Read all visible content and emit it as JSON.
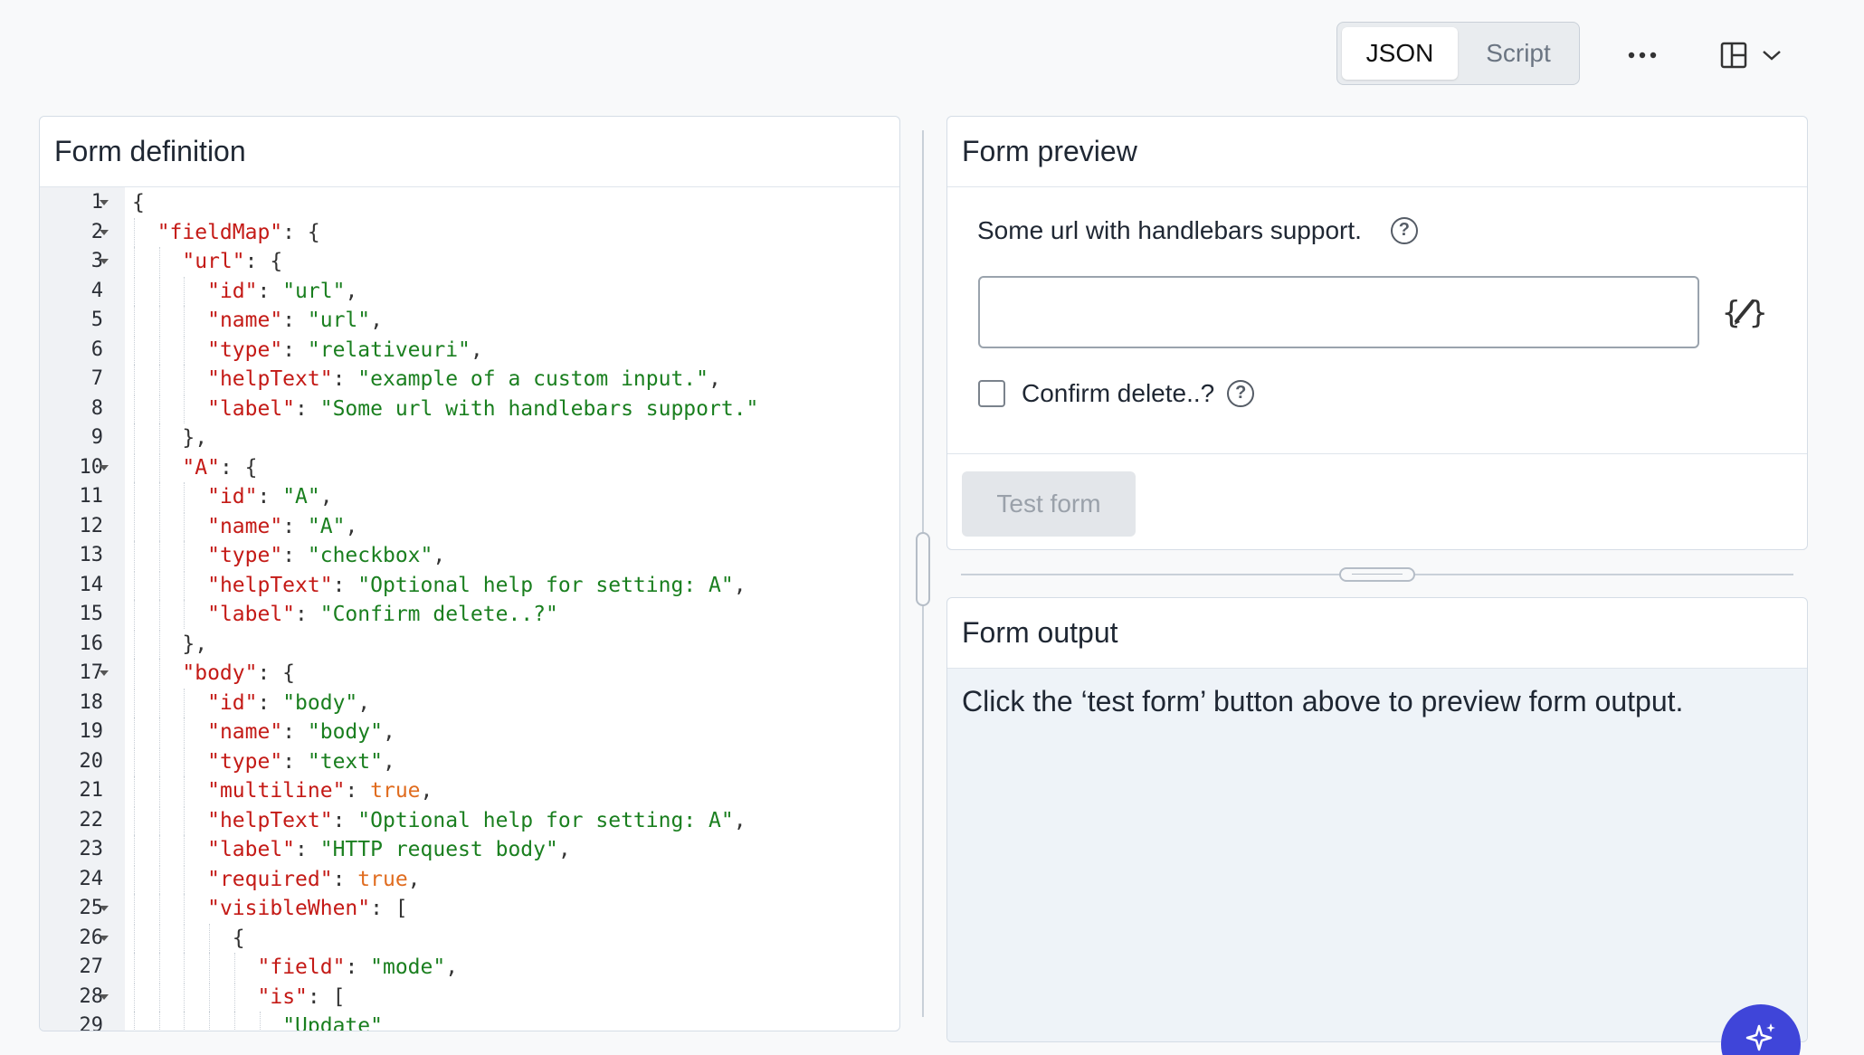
{
  "toolbar": {
    "tabs": [
      {
        "label": "JSON",
        "active": true
      },
      {
        "label": "Script",
        "active": false
      }
    ],
    "more_icon": "more-horizontal-icon",
    "layout_icon": "layout-icon"
  },
  "definition": {
    "title": "Form definition",
    "lines": [
      {
        "n": "1",
        "fold": true,
        "indent": 0,
        "tokens": [
          {
            "t": "p",
            "v": "{"
          }
        ]
      },
      {
        "n": "2",
        "fold": true,
        "indent": 1,
        "tokens": [
          {
            "t": "k",
            "v": "\"fieldMap\""
          },
          {
            "t": "p",
            "v": ": {"
          }
        ]
      },
      {
        "n": "3",
        "fold": true,
        "indent": 2,
        "tokens": [
          {
            "t": "k",
            "v": "\"url\""
          },
          {
            "t": "p",
            "v": ": {"
          }
        ]
      },
      {
        "n": "4",
        "fold": false,
        "indent": 3,
        "tokens": [
          {
            "t": "k",
            "v": "\"id\""
          },
          {
            "t": "p",
            "v": ": "
          },
          {
            "t": "s",
            "v": "\"url\""
          },
          {
            "t": "p",
            "v": ","
          }
        ]
      },
      {
        "n": "5",
        "fold": false,
        "indent": 3,
        "tokens": [
          {
            "t": "k",
            "v": "\"name\""
          },
          {
            "t": "p",
            "v": ": "
          },
          {
            "t": "s",
            "v": "\"url\""
          },
          {
            "t": "p",
            "v": ","
          }
        ]
      },
      {
        "n": "6",
        "fold": false,
        "indent": 3,
        "tokens": [
          {
            "t": "k",
            "v": "\"type\""
          },
          {
            "t": "p",
            "v": ": "
          },
          {
            "t": "s",
            "v": "\"relativeuri\""
          },
          {
            "t": "p",
            "v": ","
          }
        ]
      },
      {
        "n": "7",
        "fold": false,
        "indent": 3,
        "tokens": [
          {
            "t": "k",
            "v": "\"helpText\""
          },
          {
            "t": "p",
            "v": ": "
          },
          {
            "t": "s",
            "v": "\"example of a custom input.\""
          },
          {
            "t": "p",
            "v": ","
          }
        ]
      },
      {
        "n": "8",
        "fold": false,
        "indent": 3,
        "tokens": [
          {
            "t": "k",
            "v": "\"label\""
          },
          {
            "t": "p",
            "v": ": "
          },
          {
            "t": "s",
            "v": "\"Some url with handlebars support.\""
          }
        ]
      },
      {
        "n": "9",
        "fold": false,
        "indent": 2,
        "tokens": [
          {
            "t": "p",
            "v": "},"
          }
        ]
      },
      {
        "n": "10",
        "fold": true,
        "indent": 2,
        "tokens": [
          {
            "t": "k",
            "v": "\"A\""
          },
          {
            "t": "p",
            "v": ": {"
          }
        ]
      },
      {
        "n": "11",
        "fold": false,
        "indent": 3,
        "tokens": [
          {
            "t": "k",
            "v": "\"id\""
          },
          {
            "t": "p",
            "v": ": "
          },
          {
            "t": "s",
            "v": "\"A\""
          },
          {
            "t": "p",
            "v": ","
          }
        ]
      },
      {
        "n": "12",
        "fold": false,
        "indent": 3,
        "tokens": [
          {
            "t": "k",
            "v": "\"name\""
          },
          {
            "t": "p",
            "v": ": "
          },
          {
            "t": "s",
            "v": "\"A\""
          },
          {
            "t": "p",
            "v": ","
          }
        ]
      },
      {
        "n": "13",
        "fold": false,
        "indent": 3,
        "tokens": [
          {
            "t": "k",
            "v": "\"type\""
          },
          {
            "t": "p",
            "v": ": "
          },
          {
            "t": "s",
            "v": "\"checkbox\""
          },
          {
            "t": "p",
            "v": ","
          }
        ]
      },
      {
        "n": "14",
        "fold": false,
        "indent": 3,
        "tokens": [
          {
            "t": "k",
            "v": "\"helpText\""
          },
          {
            "t": "p",
            "v": ": "
          },
          {
            "t": "s",
            "v": "\"Optional help for setting: A\""
          },
          {
            "t": "p",
            "v": ","
          }
        ]
      },
      {
        "n": "15",
        "fold": false,
        "indent": 3,
        "tokens": [
          {
            "t": "k",
            "v": "\"label\""
          },
          {
            "t": "p",
            "v": ": "
          },
          {
            "t": "s",
            "v": "\"Confirm delete..?\""
          }
        ]
      },
      {
        "n": "16",
        "fold": false,
        "indent": 2,
        "tokens": [
          {
            "t": "p",
            "v": "},"
          }
        ]
      },
      {
        "n": "17",
        "fold": true,
        "indent": 2,
        "tokens": [
          {
            "t": "k",
            "v": "\"body\""
          },
          {
            "t": "p",
            "v": ": {"
          }
        ]
      },
      {
        "n": "18",
        "fold": false,
        "indent": 3,
        "tokens": [
          {
            "t": "k",
            "v": "\"id\""
          },
          {
            "t": "p",
            "v": ": "
          },
          {
            "t": "s",
            "v": "\"body\""
          },
          {
            "t": "p",
            "v": ","
          }
        ]
      },
      {
        "n": "19",
        "fold": false,
        "indent": 3,
        "tokens": [
          {
            "t": "k",
            "v": "\"name\""
          },
          {
            "t": "p",
            "v": ": "
          },
          {
            "t": "s",
            "v": "\"body\""
          },
          {
            "t": "p",
            "v": ","
          }
        ]
      },
      {
        "n": "20",
        "fold": false,
        "indent": 3,
        "tokens": [
          {
            "t": "k",
            "v": "\"type\""
          },
          {
            "t": "p",
            "v": ": "
          },
          {
            "t": "s",
            "v": "\"text\""
          },
          {
            "t": "p",
            "v": ","
          }
        ]
      },
      {
        "n": "21",
        "fold": false,
        "indent": 3,
        "tokens": [
          {
            "t": "k",
            "v": "\"multiline\""
          },
          {
            "t": "p",
            "v": ": "
          },
          {
            "t": "b",
            "v": "true"
          },
          {
            "t": "p",
            "v": ","
          }
        ]
      },
      {
        "n": "22",
        "fold": false,
        "indent": 3,
        "tokens": [
          {
            "t": "k",
            "v": "\"helpText\""
          },
          {
            "t": "p",
            "v": ": "
          },
          {
            "t": "s",
            "v": "\"Optional help for setting: A\""
          },
          {
            "t": "p",
            "v": ","
          }
        ]
      },
      {
        "n": "23",
        "fold": false,
        "indent": 3,
        "tokens": [
          {
            "t": "k",
            "v": "\"label\""
          },
          {
            "t": "p",
            "v": ": "
          },
          {
            "t": "s",
            "v": "\"HTTP request body\""
          },
          {
            "t": "p",
            "v": ","
          }
        ]
      },
      {
        "n": "24",
        "fold": false,
        "indent": 3,
        "tokens": [
          {
            "t": "k",
            "v": "\"required\""
          },
          {
            "t": "p",
            "v": ": "
          },
          {
            "t": "b",
            "v": "true"
          },
          {
            "t": "p",
            "v": ","
          }
        ]
      },
      {
        "n": "25",
        "fold": true,
        "indent": 3,
        "tokens": [
          {
            "t": "k",
            "v": "\"visibleWhen\""
          },
          {
            "t": "p",
            "v": ": ["
          }
        ]
      },
      {
        "n": "26",
        "fold": true,
        "indent": 4,
        "tokens": [
          {
            "t": "p",
            "v": "{"
          }
        ]
      },
      {
        "n": "27",
        "fold": false,
        "indent": 5,
        "tokens": [
          {
            "t": "k",
            "v": "\"field\""
          },
          {
            "t": "p",
            "v": ": "
          },
          {
            "t": "s",
            "v": "\"mode\""
          },
          {
            "t": "p",
            "v": ","
          }
        ]
      },
      {
        "n": "28",
        "fold": true,
        "indent": 5,
        "tokens": [
          {
            "t": "k",
            "v": "\"is\""
          },
          {
            "t": "p",
            "v": ": ["
          }
        ]
      },
      {
        "n": "29",
        "fold": false,
        "indent": 6,
        "tokens": [
          {
            "t": "s",
            "v": "\"Update\""
          }
        ]
      }
    ]
  },
  "preview": {
    "title": "Form preview",
    "url_field_label": "Some url with handlebars support.",
    "url_field_value": "",
    "handlebars_icon": "handlebars-edit-icon",
    "checkbox_label": "Confirm delete..?",
    "checkbox_checked": false,
    "help_icon": "help-circle-icon",
    "test_button": "Test form"
  },
  "output": {
    "title": "Form output",
    "message": "Click the ‘test form’ button above to preview form output."
  },
  "fab_icon": "sparkle-icon",
  "colors": {
    "key": "#c41a16",
    "string": "#1a7f1f",
    "boolean": "#e06c1f",
    "accent": "#3f45d9"
  }
}
